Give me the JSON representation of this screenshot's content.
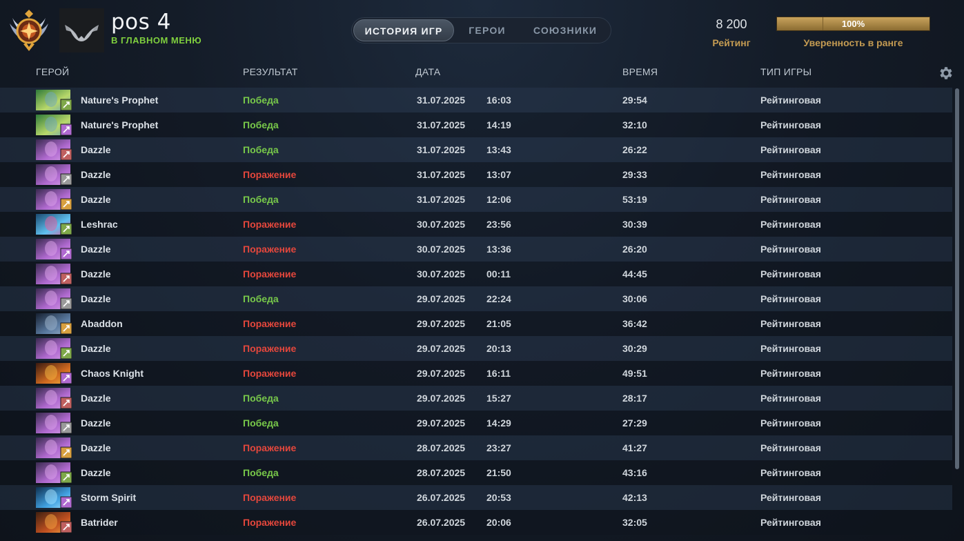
{
  "player": {
    "name": "pos 4",
    "status": "В ГЛАВНОМ МЕНЮ"
  },
  "tabs": [
    {
      "label": "ИСТОРИЯ ИГР",
      "active": true
    },
    {
      "label": "ГЕРОИ",
      "active": false
    },
    {
      "label": "СОЮЗНИКИ",
      "active": false
    }
  ],
  "rating": {
    "value": "8 200",
    "label": "Рейтинг"
  },
  "confidence": {
    "value": "100%",
    "label": "Уверенность в ранге",
    "fraction": 1.0
  },
  "columns": {
    "hero": "ГЕРОЙ",
    "result": "РЕЗУЛЬТАТ",
    "date": "ДАТА",
    "duration": "ВРЕМЯ",
    "game_type": "ТИП ИГРЫ"
  },
  "settings_icon": "gear-icon",
  "colors": {
    "win": "#78c94a",
    "loss": "#e5473c",
    "accent_gold": "#c49b52",
    "status_green": "#7fcf3e"
  },
  "matches": [
    {
      "hero": "Nature's Prophet",
      "result": "Победа",
      "win": true,
      "date": "31.07.2025",
      "time": "16:03",
      "duration": "29:54",
      "type": "Рейтинговая",
      "portrait": "natures-prophet",
      "role_icon": "role-badge-icon"
    },
    {
      "hero": "Nature's Prophet",
      "result": "Победа",
      "win": true,
      "date": "31.07.2025",
      "time": "14:19",
      "duration": "32:10",
      "type": "Рейтинговая",
      "portrait": "natures-prophet",
      "role_icon": "role-badge-icon"
    },
    {
      "hero": "Dazzle",
      "result": "Победа",
      "win": true,
      "date": "31.07.2025",
      "time": "13:43",
      "duration": "26:22",
      "type": "Рейтинговая",
      "portrait": "dazzle",
      "role_icon": "role-badge-icon"
    },
    {
      "hero": "Dazzle",
      "result": "Поражение",
      "win": false,
      "date": "31.07.2025",
      "time": "13:07",
      "duration": "29:33",
      "type": "Рейтинговая",
      "portrait": "dazzle",
      "role_icon": "role-badge-icon"
    },
    {
      "hero": "Dazzle",
      "result": "Победа",
      "win": true,
      "date": "31.07.2025",
      "time": "12:06",
      "duration": "53:19",
      "type": "Рейтинговая",
      "portrait": "dazzle",
      "role_icon": "role-badge-icon"
    },
    {
      "hero": "Leshrac",
      "result": "Поражение",
      "win": false,
      "date": "30.07.2025",
      "time": "23:56",
      "duration": "30:39",
      "type": "Рейтинговая",
      "portrait": "leshrac",
      "role_icon": "role-badge-icon"
    },
    {
      "hero": "Dazzle",
      "result": "Поражение",
      "win": false,
      "date": "30.07.2025",
      "time": "13:36",
      "duration": "26:20",
      "type": "Рейтинговая",
      "portrait": "dazzle",
      "role_icon": "role-badge-icon"
    },
    {
      "hero": "Dazzle",
      "result": "Поражение",
      "win": false,
      "date": "30.07.2025",
      "time": "00:11",
      "duration": "44:45",
      "type": "Рейтинговая",
      "portrait": "dazzle",
      "role_icon": "role-badge-icon"
    },
    {
      "hero": "Dazzle",
      "result": "Победа",
      "win": true,
      "date": "29.07.2025",
      "time": "22:24",
      "duration": "30:06",
      "type": "Рейтинговая",
      "portrait": "dazzle",
      "role_icon": "role-badge-icon"
    },
    {
      "hero": "Abaddon",
      "result": "Поражение",
      "win": false,
      "date": "29.07.2025",
      "time": "21:05",
      "duration": "36:42",
      "type": "Рейтинговая",
      "portrait": "abaddon",
      "role_icon": "role-badge-icon"
    },
    {
      "hero": "Dazzle",
      "result": "Поражение",
      "win": false,
      "date": "29.07.2025",
      "time": "20:13",
      "duration": "30:29",
      "type": "Рейтинговая",
      "portrait": "dazzle",
      "role_icon": "role-badge-icon"
    },
    {
      "hero": "Chaos Knight",
      "result": "Поражение",
      "win": false,
      "date": "29.07.2025",
      "time": "16:11",
      "duration": "49:51",
      "type": "Рейтинговая",
      "portrait": "chaos-knight",
      "role_icon": "role-badge-icon"
    },
    {
      "hero": "Dazzle",
      "result": "Победа",
      "win": true,
      "date": "29.07.2025",
      "time": "15:27",
      "duration": "28:17",
      "type": "Рейтинговая",
      "portrait": "dazzle",
      "role_icon": "role-badge-icon"
    },
    {
      "hero": "Dazzle",
      "result": "Победа",
      "win": true,
      "date": "29.07.2025",
      "time": "14:29",
      "duration": "27:29",
      "type": "Рейтинговая",
      "portrait": "dazzle",
      "role_icon": "role-badge-icon"
    },
    {
      "hero": "Dazzle",
      "result": "Поражение",
      "win": false,
      "date": "28.07.2025",
      "time": "23:27",
      "duration": "41:27",
      "type": "Рейтинговая",
      "portrait": "dazzle",
      "role_icon": "role-badge-icon"
    },
    {
      "hero": "Dazzle",
      "result": "Победа",
      "win": true,
      "date": "28.07.2025",
      "time": "21:50",
      "duration": "43:16",
      "type": "Рейтинговая",
      "portrait": "dazzle",
      "role_icon": "role-badge-icon"
    },
    {
      "hero": "Storm Spirit",
      "result": "Поражение",
      "win": false,
      "date": "26.07.2025",
      "time": "20:53",
      "duration": "42:13",
      "type": "Рейтинговая",
      "portrait": "storm-spirit",
      "role_icon": "role-badge-icon"
    },
    {
      "hero": "Batrider",
      "result": "Поражение",
      "win": false,
      "date": "26.07.2025",
      "time": "20:06",
      "duration": "32:05",
      "type": "Рейтинговая",
      "portrait": "batrider",
      "role_icon": "role-badge-icon"
    }
  ]
}
